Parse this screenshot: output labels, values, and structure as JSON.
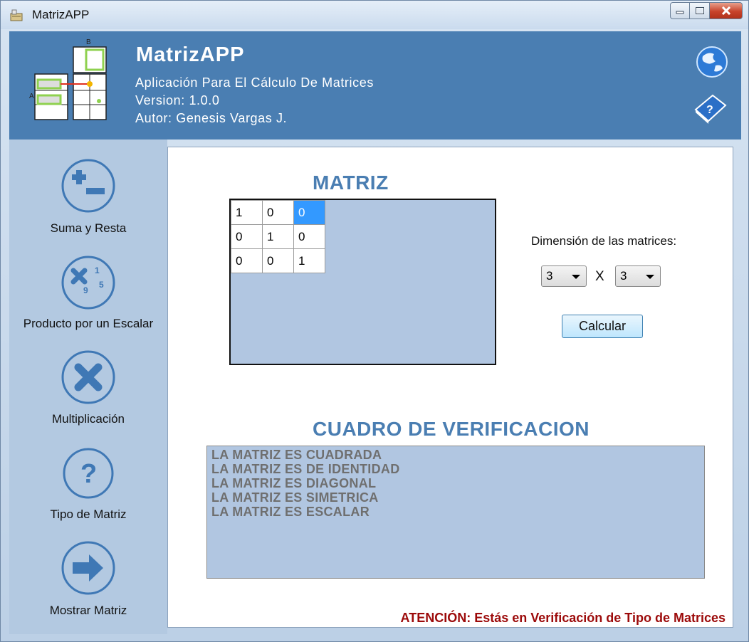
{
  "window": {
    "title": "MatrizAPP"
  },
  "header": {
    "title": "MatrizAPP",
    "subtitle": "Aplicación Para El Cálculo De Matrices",
    "version": "Version: 1.0.0",
    "author": "Autor: Genesis Vargas J.",
    "logo_label_a": "A",
    "logo_label_b": "B"
  },
  "sidebar": {
    "items": [
      {
        "label": "Suma y Resta",
        "icon": "plus-minus-icon"
      },
      {
        "label": "Producto por un Escalar",
        "icon": "scalar-product-icon"
      },
      {
        "label": "Multiplicación",
        "icon": "multiply-icon"
      },
      {
        "label": "Tipo de Matriz",
        "icon": "question-icon"
      },
      {
        "label": "Mostrar Matriz",
        "icon": "arrow-right-icon"
      }
    ]
  },
  "main": {
    "matrix_title": "MATRIZ",
    "matrix": [
      [
        "1",
        "0",
        "0"
      ],
      [
        "0",
        "1",
        "0"
      ],
      [
        "0",
        "0",
        "1"
      ]
    ],
    "dimension_label": "Dimensión de las matrices:",
    "rows_value": "3",
    "x_label": "X",
    "cols_value": "3",
    "calc_button": "Calcular",
    "verification_title": "CUADRO DE VERIFICACION",
    "verification_lines": [
      "LA MATRIZ ES CUADRADA",
      "LA MATRIZ ES DE IDENTIDAD",
      "LA MATRIZ ES DIAGONAL",
      "LA MATRIZ ES SIMETRICA",
      "LA MATRIZ ES ESCALAR"
    ],
    "attention": "ATENCIÓN: Estás en Verificación de Tipo de Matrices"
  },
  "colors": {
    "header_bg": "#4a7eb2",
    "sidebar_bg": "#b3c9e1",
    "panel_bg": "#b1c6e1",
    "accent_title": "#4a7eb2",
    "attention": "#9c0a0a"
  }
}
